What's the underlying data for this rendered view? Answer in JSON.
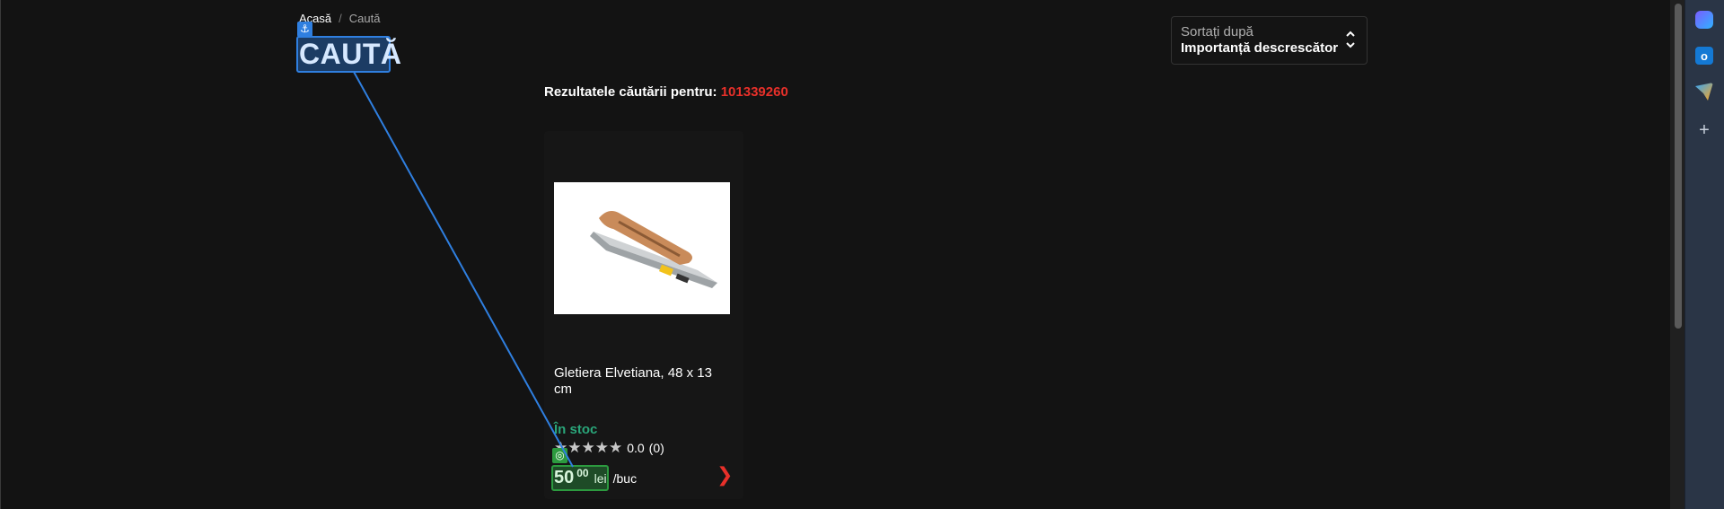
{
  "breadcrumb": {
    "home": "Acasă",
    "separator": "/",
    "current": "Caută"
  },
  "page": {
    "title": "CAUTĂ"
  },
  "sort": {
    "label": "Sortați după",
    "value": "Importanță descrescător"
  },
  "results": {
    "prefix": "Rezultatele căutării pentru:",
    "query": "101339260"
  },
  "product": {
    "name": "Gletiera Elvetiana, 48 x 13 cm",
    "stock": "În stoc",
    "stars": "★★★★★",
    "rating_value": "0.0",
    "rating_count": "(0)",
    "price_int": "50",
    "price_dec": "00",
    "currency": "lei",
    "unit": "/buc"
  },
  "overlay": {
    "anchor_icon": "anchor-icon",
    "target_icon": "target-icon",
    "highlight_color": "#2f7fe0",
    "target_color": "#2c9a3f"
  },
  "sidebar": {
    "icons": [
      "copilot-icon",
      "outlook-icon",
      "send-icon",
      "add-icon"
    ]
  },
  "colors": {
    "background": "#131313",
    "accent_red": "#e8302a",
    "stock_green": "#2aa67a"
  }
}
